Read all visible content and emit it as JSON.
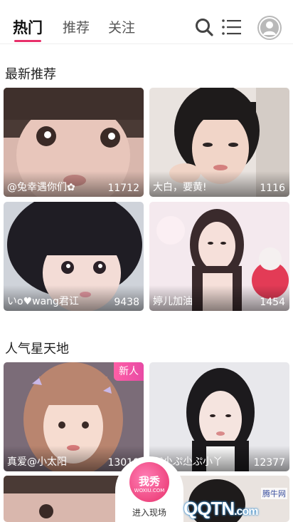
{
  "header": {
    "tabs": [
      {
        "label": "热门",
        "active": true
      },
      {
        "label": "推荐",
        "active": false
      },
      {
        "label": "关注",
        "active": false
      }
    ],
    "icons": [
      "search-icon",
      "list-icon",
      "avatar-icon"
    ],
    "accent_color": "#e8306a"
  },
  "sections": [
    {
      "title": "最新推荐",
      "cards": [
        {
          "name": "@兔幸遇你们✿",
          "count": "11712"
        },
        {
          "name": "大白，要黄!",
          "count": "1116"
        },
        {
          "name": "いo♥wang君讧",
          "count": "9438"
        },
        {
          "name": "婷儿加油",
          "count": "1454"
        }
      ]
    },
    {
      "title": "人气星天地",
      "cards": [
        {
          "name": "真爱@小太阳",
          "count": "13018",
          "badge": "新人"
        },
        {
          "name": "ぷ尐ぷ尐ぷ小丫",
          "count": "12377"
        }
      ]
    }
  ],
  "promo": {
    "logo_text": "我秀",
    "logo_sub": "WOXIU.COM",
    "enter_label": "进入现场"
  },
  "watermark": {
    "brand": "QQTN",
    "suffix": ".com",
    "site_label": "腾牛网"
  }
}
